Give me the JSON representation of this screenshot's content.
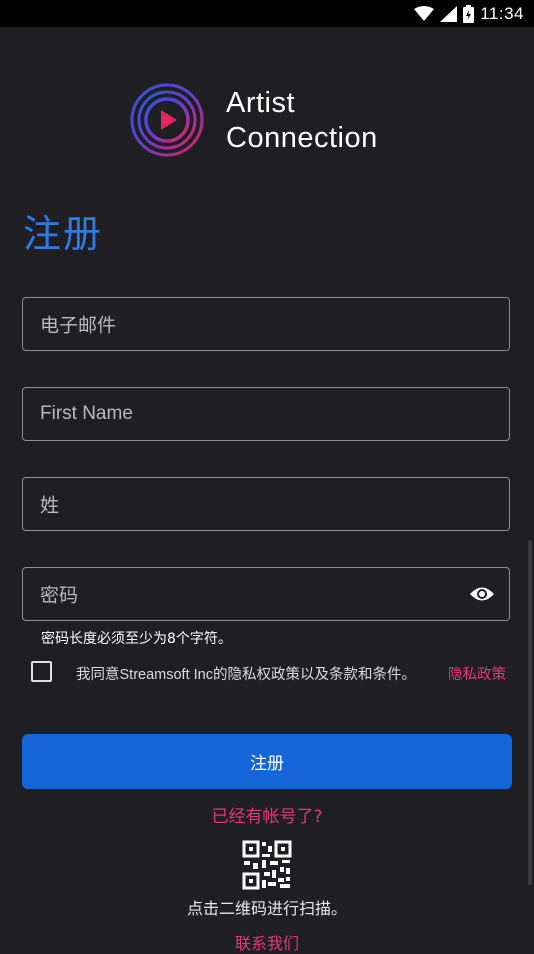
{
  "status_bar": {
    "time": "11:34"
  },
  "brand": {
    "line1": "Artist",
    "line2": "Connection"
  },
  "page_title": "注册",
  "fields": {
    "email_placeholder": "电子邮件",
    "first_name_placeholder": "First Name",
    "last_name_placeholder": "姓",
    "password_placeholder": "密码"
  },
  "password_hint": "密码长度必须至少为8个字符。",
  "terms": {
    "agree_text": "我同意Streamsoft Inc的隐私权政策以及条款和条件。",
    "privacy_link": "隐私政策"
  },
  "submit_label": "注册",
  "have_account_link": "已经有帐号了?",
  "scan_text": "点击二维码进行扫描。",
  "contact_link": "联系我们",
  "colors": {
    "accent_blue": "#1565d8",
    "title_blue": "#2f7be6",
    "link_pink": "#e03b6e",
    "background": "#1f1f23"
  },
  "icons": [
    "wifi-icon",
    "signal-icon",
    "battery-icon",
    "eye-icon",
    "qr-code-icon",
    "play-logo-icon"
  ]
}
